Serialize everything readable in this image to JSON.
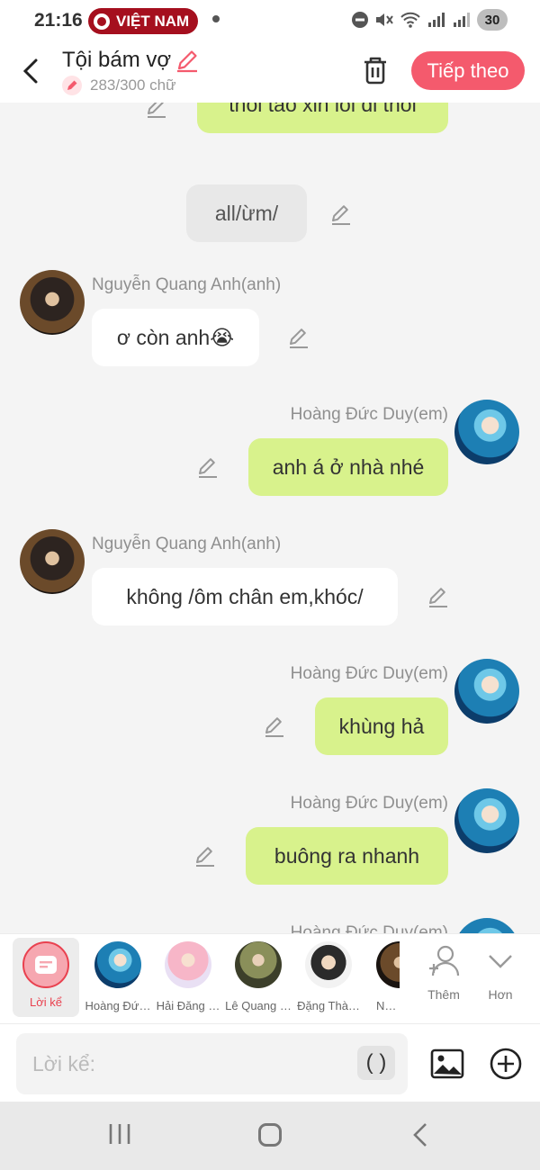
{
  "status_bar": {
    "time": "21:16",
    "badge": "VIỆT NAM",
    "battery": "30"
  },
  "header": {
    "title": "Tội bám vợ",
    "char_count": "283/300 chữ",
    "next_label": "Tiếp theo"
  },
  "chat": {
    "partial_top": {
      "text": "thôi tao xin lỗi đi thôi"
    },
    "narration": {
      "text": "all/ừm/"
    },
    "messages": [
      {
        "sender": "Nguyễn Quang Anh(anh)",
        "text": "ơ còn anh😭",
        "side": "left"
      },
      {
        "sender": "Hoàng Đức Duy(em)",
        "text": "anh á ở nhà nhé",
        "side": "right"
      },
      {
        "sender": "Nguyễn Quang Anh(anh)",
        "text": "không /ôm chân em,khóc/",
        "side": "left"
      },
      {
        "sender": "Hoàng Đức Duy(em)",
        "text": "khùng hả",
        "side": "right"
      },
      {
        "sender": "Hoàng Đức Duy(em)",
        "text": "buông ra nhanh",
        "side": "right"
      },
      {
        "sender": "Hoàng Đức Duy(em)",
        "text": "",
        "side": "right"
      }
    ]
  },
  "character_bar": {
    "narrator_label": "Lời kể",
    "characters": [
      {
        "name": "Hoàng Đứ…",
        "color": "#1d7fb4"
      },
      {
        "name": "Hải Đăng …",
        "color": "#f7b6c8"
      },
      {
        "name": "Lê Quang …",
        "color": "#8a8f5a"
      },
      {
        "name": "Đặng Thà…",
        "color": "#2b2b2b"
      },
      {
        "name": "Nguy…",
        "color": "#6b4a2a"
      }
    ],
    "add_label": "Thêm",
    "more_label": "Hơn"
  },
  "input": {
    "placeholder": "Lời kể:",
    "paren": "( )"
  },
  "colors": {
    "accent": "#f45a6d",
    "my_bubble": "#d8f28c",
    "their_bubble": "#ffffff"
  }
}
